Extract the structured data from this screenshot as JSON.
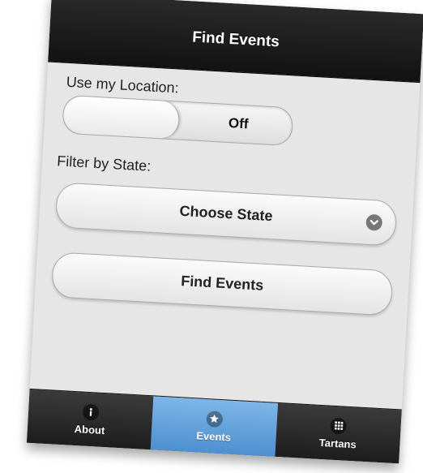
{
  "header": {
    "title": "Find Events"
  },
  "location": {
    "label": "Use my Location:",
    "toggle_state": "Off"
  },
  "filter": {
    "label": "Filter by State:",
    "select_value": "Choose State"
  },
  "actions": {
    "find_label": "Find Events"
  },
  "tabs": [
    {
      "label": "About",
      "icon": "info-icon",
      "active": false
    },
    {
      "label": "Events",
      "icon": "star-icon",
      "active": true
    },
    {
      "label": "Tartans",
      "icon": "grid-icon",
      "active": false
    }
  ],
  "colors": {
    "header": "#161616",
    "active_tab": "#5f9fda",
    "background": "#e6e6e6"
  }
}
